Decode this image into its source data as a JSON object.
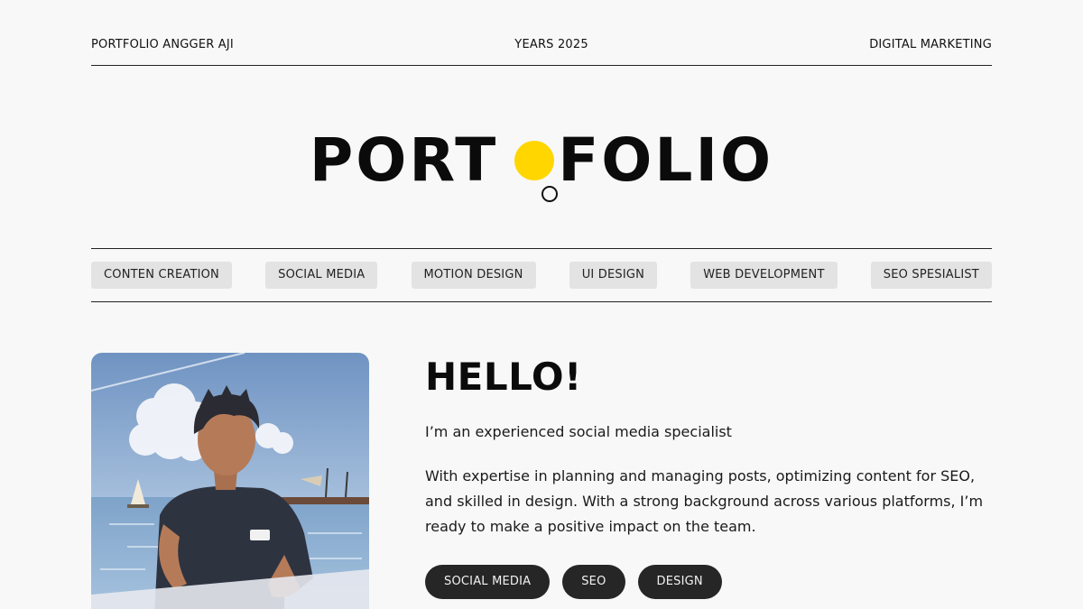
{
  "header": {
    "left": "PORTFOLIO ANGGER AJI",
    "center": "YEARS 2025",
    "right": "DIGITAL MARKETING"
  },
  "hero": {
    "title_left": "PORT",
    "title_right": "FOLIO",
    "accent_color": "#ffd600"
  },
  "skills": [
    "CONTEN CREATION",
    "SOCIAL MEDIA",
    "MOTION DESIGN",
    "UI DESIGN",
    "WEB DEVELOPMENT",
    "SEO SPESIALIST"
  ],
  "about": {
    "heading": "HELLO!",
    "intro": "I’m an experienced social media specialist",
    "description": "With expertise in planning and managing posts, optimizing content for SEO, and skilled in design. With a strong background across various platforms, I’m ready to make a positive impact on the team.",
    "tags": [
      "SOCIAL MEDIA",
      "SEO",
      "DESIGN"
    ]
  },
  "photo": {
    "icon": "illustrated-portrait"
  }
}
